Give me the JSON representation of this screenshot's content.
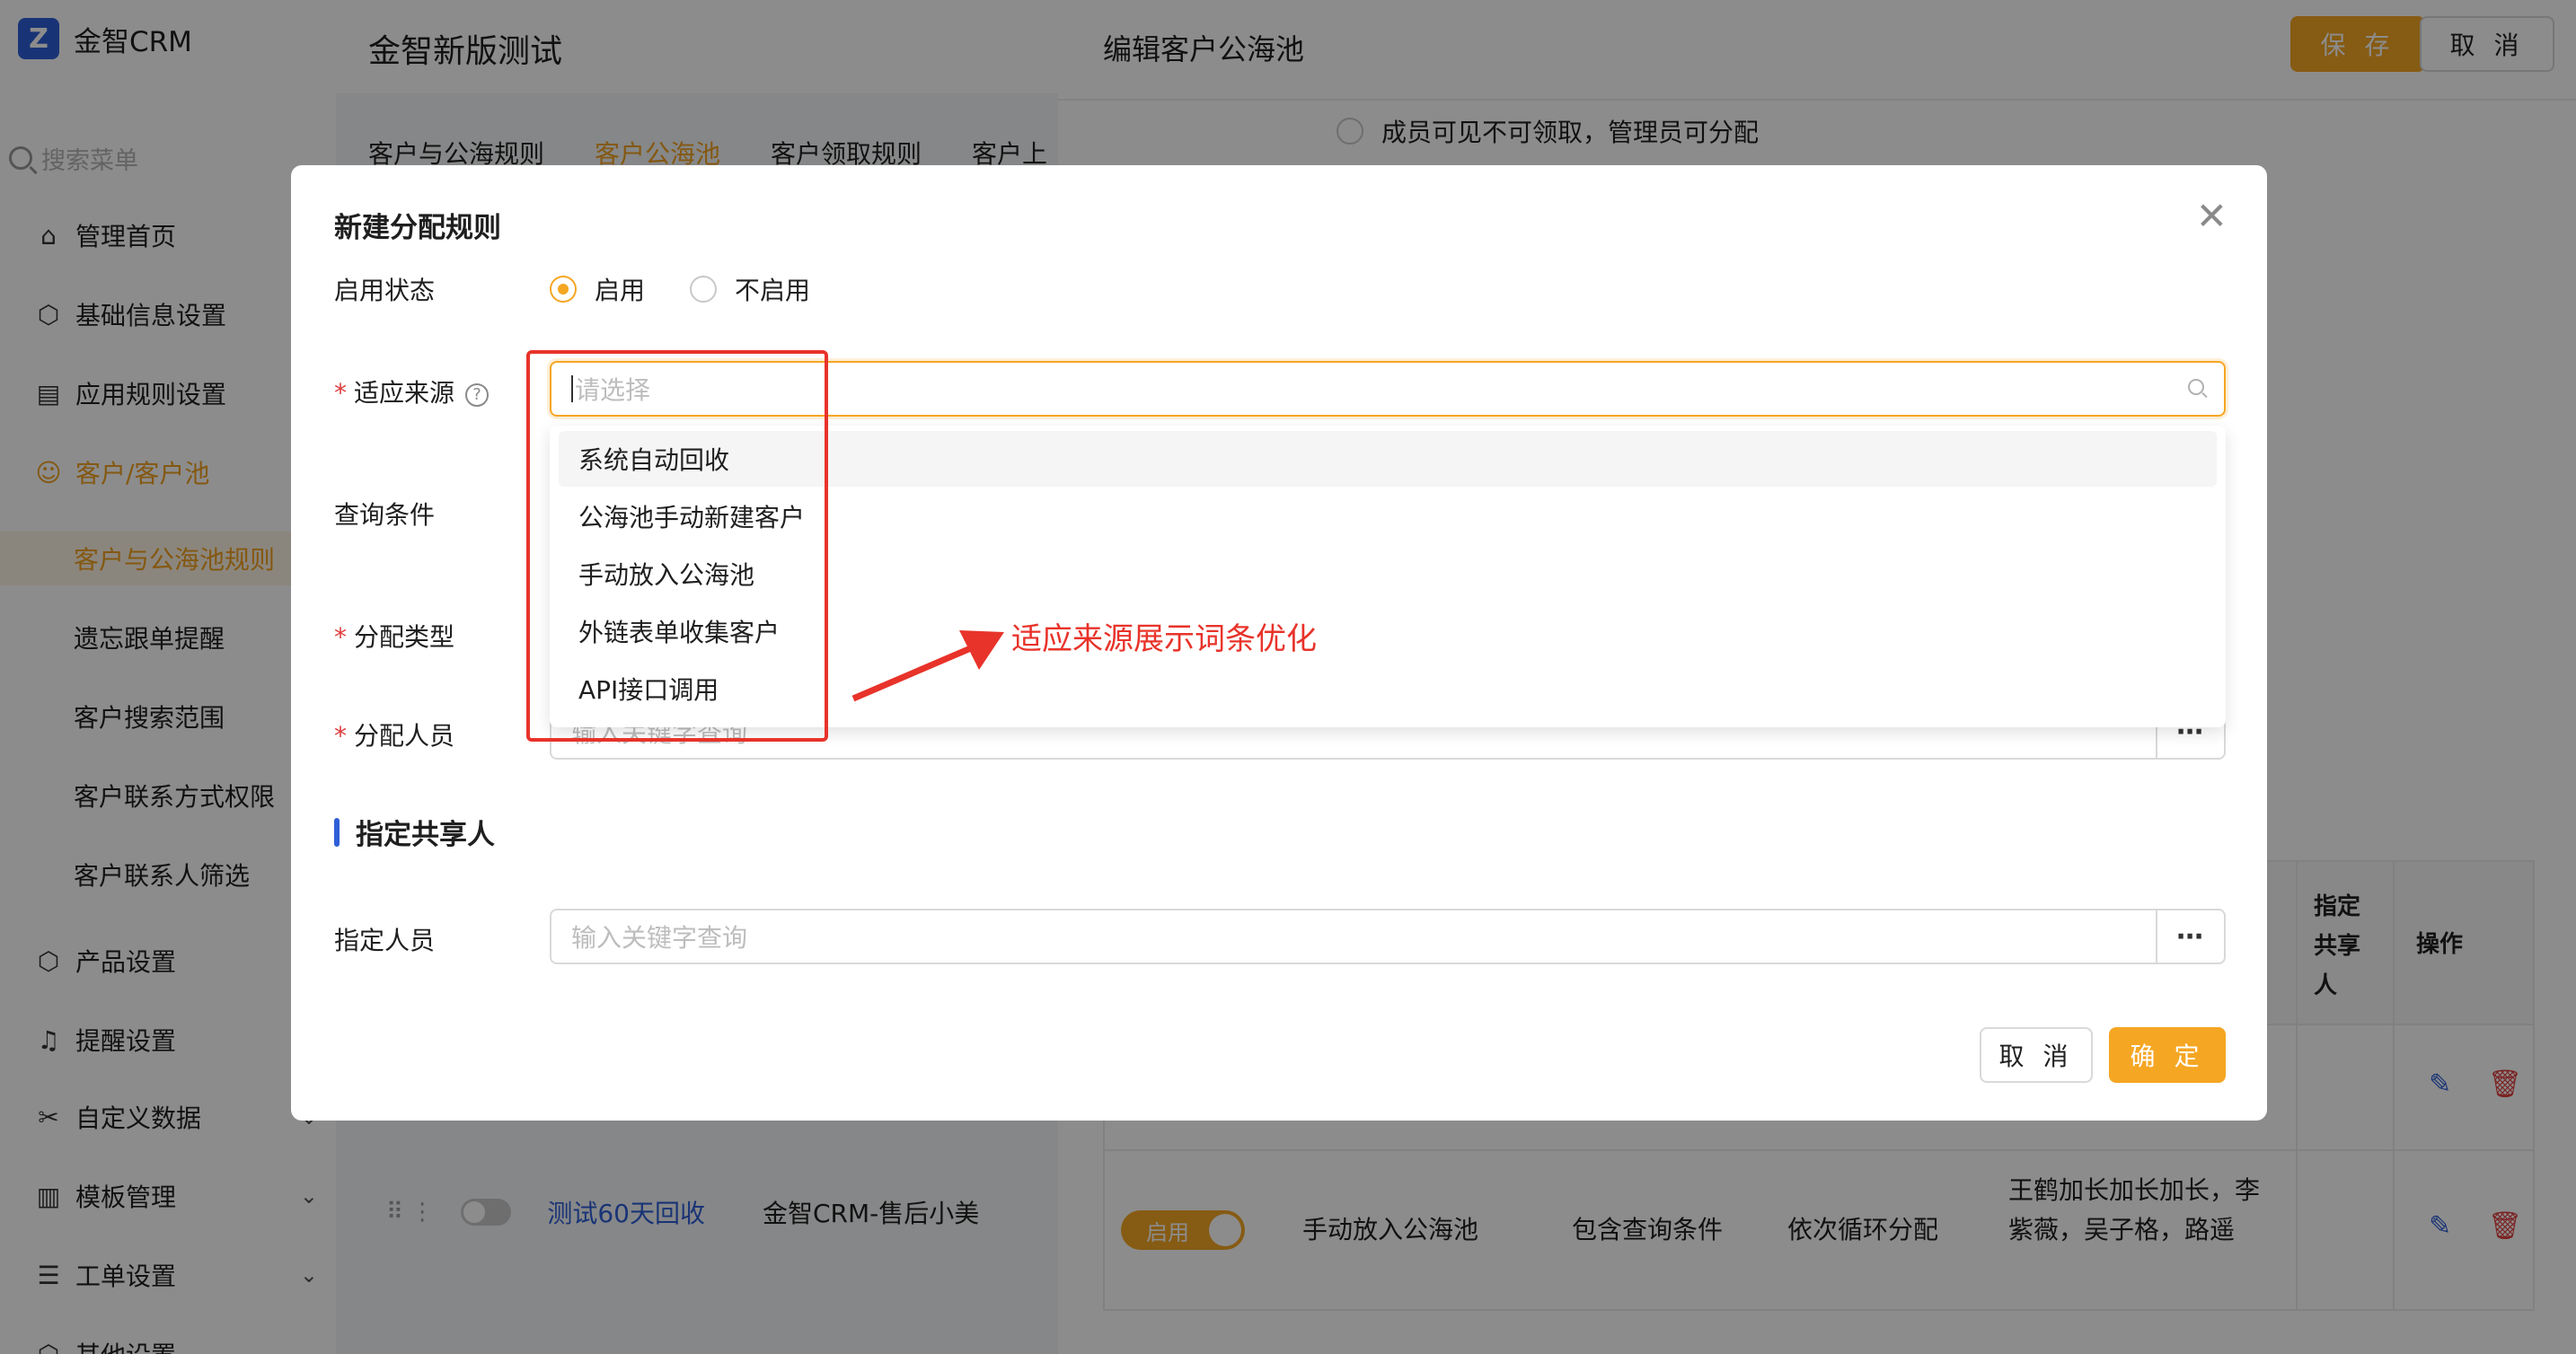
{
  "sidebar": {
    "brand": "金智CRM",
    "search_placeholder": "搜索菜单",
    "items": [
      {
        "label": "管理首页",
        "icon": "home-icon"
      },
      {
        "label": "基础信息设置",
        "icon": "cube-icon"
      },
      {
        "label": "应用规则设置",
        "icon": "document-icon"
      },
      {
        "label": "客户/客户池",
        "icon": "users-icon"
      },
      {
        "label": "产品设置",
        "icon": "cube-icon"
      },
      {
        "label": "提醒设置",
        "icon": "bell-icon"
      },
      {
        "label": "自定义数据",
        "icon": "tools-icon"
      },
      {
        "label": "模板管理",
        "icon": "template-icon"
      },
      {
        "label": "工单设置",
        "icon": "list-icon"
      },
      {
        "label": "其他设置",
        "icon": "cube-icon"
      }
    ],
    "sub_items": [
      "客户与公海池规则",
      "遗忘跟单提醒",
      "客户搜索范围",
      "客户联系方式权限",
      "客户联系人筛选"
    ]
  },
  "main": {
    "title": "金智新版测试",
    "tabs": [
      "客户与公海规则",
      "客户公海池",
      "客户领取规则",
      "客户上"
    ],
    "row": {
      "name": "测试60天回收",
      "owner": "金智CRM-售后小美"
    }
  },
  "drawer": {
    "title": "编辑客户公海池",
    "save": "保 存",
    "cancel": "取 消",
    "radio_option": "成员可见不可领取，管理员可分配",
    "table": {
      "headers": [
        "指定共享人",
        "操作"
      ],
      "row2": {
        "status": "启用",
        "source": "手动放入公海池",
        "condition": "包含查询条件",
        "type": "依次循环分配",
        "people": "王鹤加长加长加长，李紫薇，吴子格，路遥"
      }
    }
  },
  "modal": {
    "title": "新建分配规则",
    "status_label": "启用状态",
    "status_options": [
      "启用",
      "不启用"
    ],
    "status_selected": 0,
    "source_label": "适应来源",
    "source_placeholder": "请选择",
    "source_options": [
      "系统自动回收",
      "公海池手动新建客户",
      "手动放入公海池",
      "外链表单收集客户",
      "API接口调用"
    ],
    "query_label": "查询条件",
    "type_label": "分配类型",
    "assignee_label": "分配人员",
    "assignee_placeholder": "输入关键字查询",
    "section_title": "指定共享人",
    "share_label": "指定人员",
    "share_placeholder": "输入关键字查询",
    "cancel": "取 消",
    "ok": "确 定"
  },
  "annotation": {
    "text": "适应来源展示词条优化",
    "color": "#e8332a"
  },
  "colors": {
    "accent": "#f5a623",
    "link": "#2f5fd8",
    "danger": "#e03c3c"
  }
}
